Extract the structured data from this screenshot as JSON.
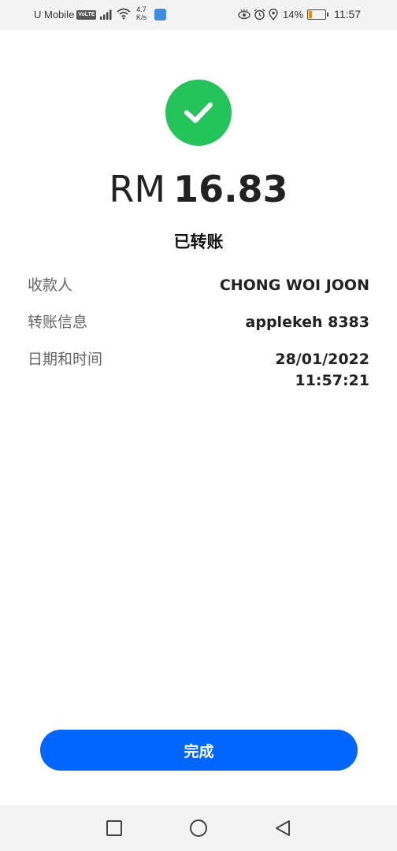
{
  "status_bar": {
    "carrier": "U Mobile",
    "volte": "VoLTE",
    "speed_value": "4.7",
    "speed_unit": "K/s",
    "battery_percent": "14%",
    "battery_level": 0.14,
    "time": "11:57"
  },
  "receipt": {
    "currency": "RM",
    "amount": "16.83",
    "status": "已转账"
  },
  "details": [
    {
      "label": "收款人",
      "value": "CHONG WOI JOON"
    },
    {
      "label": "转账信息",
      "value": "applekeh 8383"
    },
    {
      "label": "日期和时间",
      "value_date": "28/01/2022",
      "value_time": "11:57:21"
    }
  ],
  "done_button": {
    "label": "完成"
  },
  "colors": {
    "success": "#24c45b",
    "primary": "#0066ff",
    "battery": "#f08a00"
  },
  "icons": {
    "success": "check-circle-icon",
    "recents": "square-icon",
    "home": "circle-icon",
    "back": "triangle-back-icon"
  }
}
